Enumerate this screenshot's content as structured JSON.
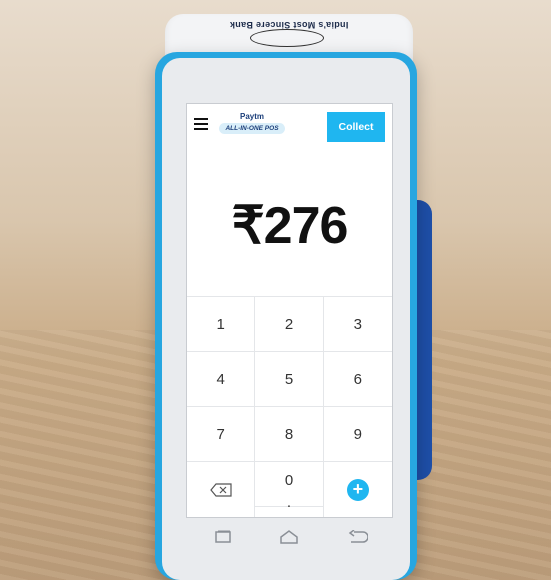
{
  "device": {
    "printer_label": "India's Most Sincere Bank"
  },
  "header": {
    "brand": "Paytm",
    "product": "ALL-IN-ONE POS",
    "collect_label": "Collect"
  },
  "amount": {
    "currency": "₹",
    "value": "276"
  },
  "keypad": {
    "keys": [
      "1",
      "2",
      "3",
      "4",
      "5",
      "6",
      "7",
      "8",
      "9",
      "0",
      "."
    ]
  },
  "icons": {
    "menu": "hamburger-icon",
    "backspace": "backspace-icon",
    "add": "plus-icon",
    "recents": "recents-icon",
    "home": "home-icon",
    "back": "back-icon"
  },
  "colors": {
    "accent": "#1fb6f0",
    "device_body": "#27a6e0",
    "brand_dark": "#1b3e7a"
  }
}
